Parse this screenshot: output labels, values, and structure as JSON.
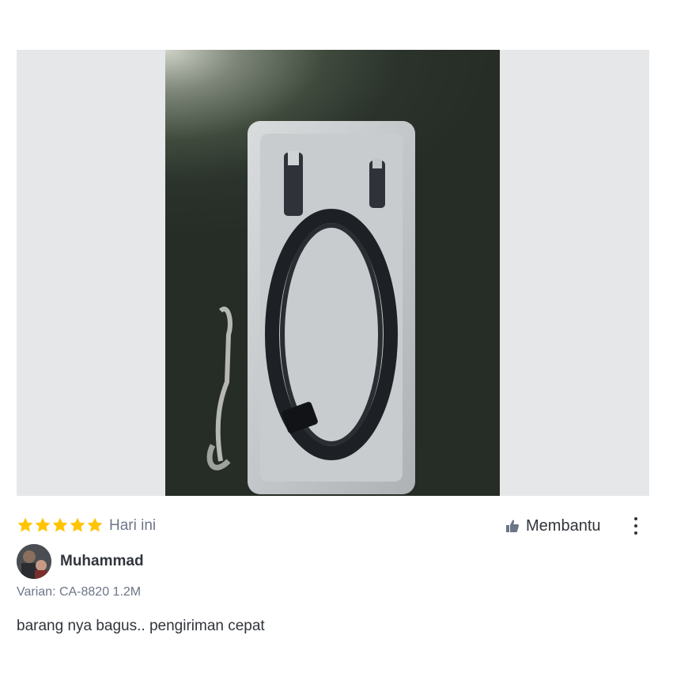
{
  "review": {
    "rating": 5,
    "rating_max": 5,
    "date": "Hari ini",
    "helpful_label": "Membantu",
    "user_name": "Muhammad",
    "variant": "Varian: CA-8820 1.2M",
    "text": "barang nya bagus.. pengiriman cepat"
  },
  "colors": {
    "star": "#ffc400",
    "text_primary": "#31353b",
    "text_secondary": "#6d7588",
    "media_bg": "#e5e7e9"
  },
  "icons": {
    "star": "star-icon",
    "helpful": "thumbs-up-icon",
    "more": "more-vertical-icon"
  }
}
